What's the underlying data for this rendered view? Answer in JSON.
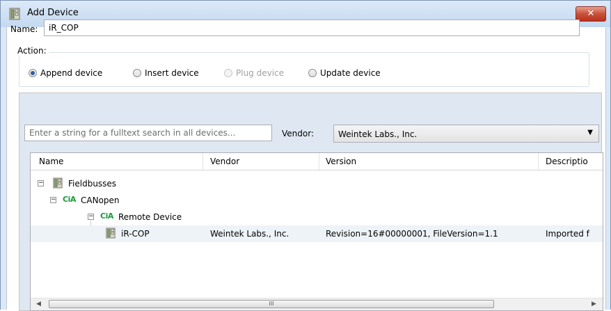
{
  "window": {
    "title": "Add Device",
    "close_label": "✕"
  },
  "name_field": {
    "label": "Name:",
    "value": "iR_COP"
  },
  "action": {
    "label": "Action:",
    "options": [
      {
        "label": "Append device",
        "selected": true,
        "enabled": true
      },
      {
        "label": "Insert device",
        "selected": false,
        "enabled": true
      },
      {
        "label": "Plug device",
        "selected": false,
        "enabled": false
      },
      {
        "label": "Update device",
        "selected": false,
        "enabled": true
      }
    ]
  },
  "search": {
    "placeholder": "Enter a string for a fulltext search in all devices..."
  },
  "vendor": {
    "label": "Vendor:",
    "value": "Weintek Labs., Inc."
  },
  "table": {
    "columns": [
      "Name",
      "Vendor",
      "Version",
      "Descriptio"
    ],
    "rows": [
      {
        "name": "Fieldbusses",
        "icon": "device-icon",
        "vendor": "",
        "version": "",
        "description": ""
      },
      {
        "name": "CANopen",
        "icon": "cia-icon",
        "icon_text": "CiA",
        "vendor": "",
        "version": "",
        "description": ""
      },
      {
        "name": "Remote Device",
        "icon": "cia-icon",
        "icon_text": "CiA",
        "vendor": "",
        "version": "",
        "description": ""
      },
      {
        "name": "iR-COP",
        "icon": "device-icon",
        "vendor": "Weintek Labs., Inc.",
        "version": "Revision=16#00000001, FileVersion=1.1",
        "description": "Imported f"
      }
    ]
  },
  "scrollbar": {
    "left_arrow": "◀",
    "right_arrow": "▶",
    "grip": "III"
  },
  "colors": {
    "title_bar": "#c4d8ef",
    "close_button": "#c8503a",
    "cia_green": "#189a3a"
  }
}
